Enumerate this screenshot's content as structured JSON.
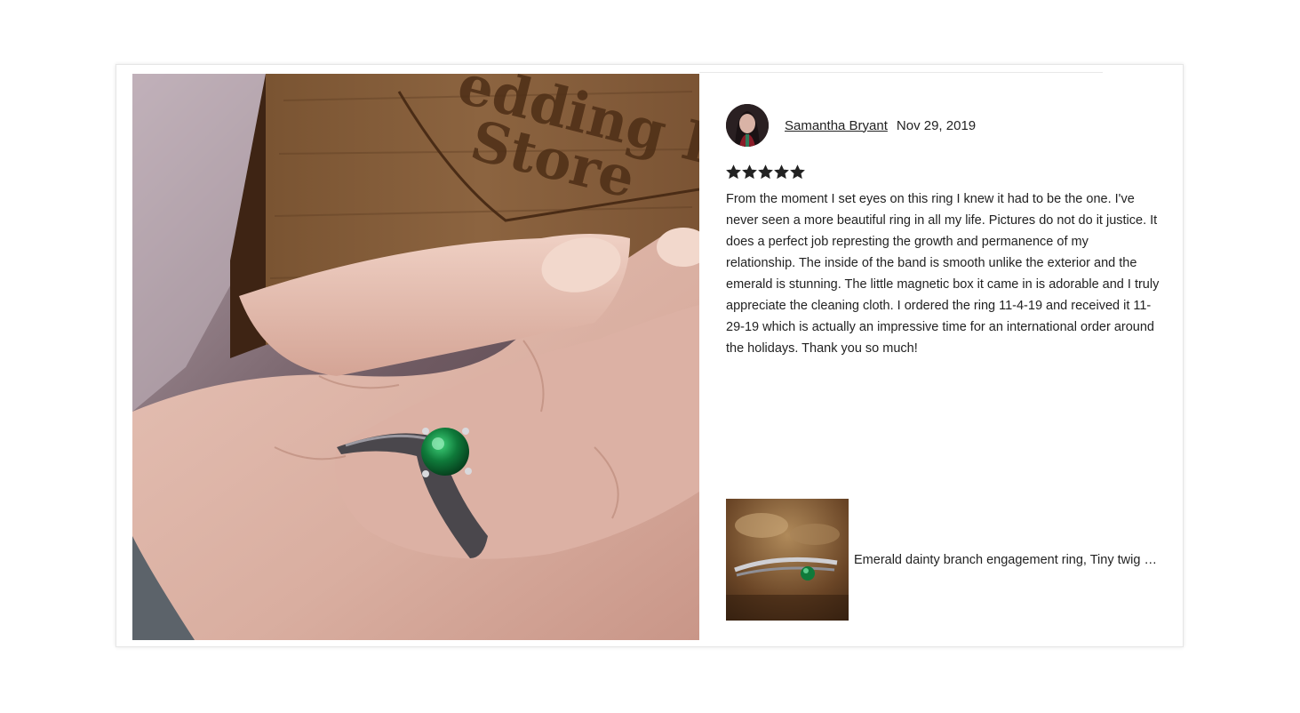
{
  "review": {
    "author_name": "Samantha Bryant",
    "date": "Nov 29, 2019",
    "rating": 5,
    "rating_max": 5,
    "text": "From the moment I set eyes on this ring I knew it had to be the one. I've never seen a more beautiful ring in all my life. Pictures do not do it justice. It does a perfect job represting the growth and permanence of my relationship. The inside of the band is smooth unlike the exterior and the emerald is stunning. The little magnetic box it came in is adorable and I truly appreciate the cleaning cloth. I ordered the ring 11-4-19 and received it 11-29-19 which is actually an impressive time for an international order around the holidays. Thank you so much!"
  },
  "photo": {
    "box_text_line1": "edding Rin",
    "box_text_line2": "Store"
  },
  "listing": {
    "title": "Emerald dainty branch engagement ring, Tiny twig engagement ring"
  },
  "colors": {
    "text": "#222222",
    "star": "#222222",
    "card_border": "#e6e6e6",
    "emerald": "#0f7a3a"
  }
}
